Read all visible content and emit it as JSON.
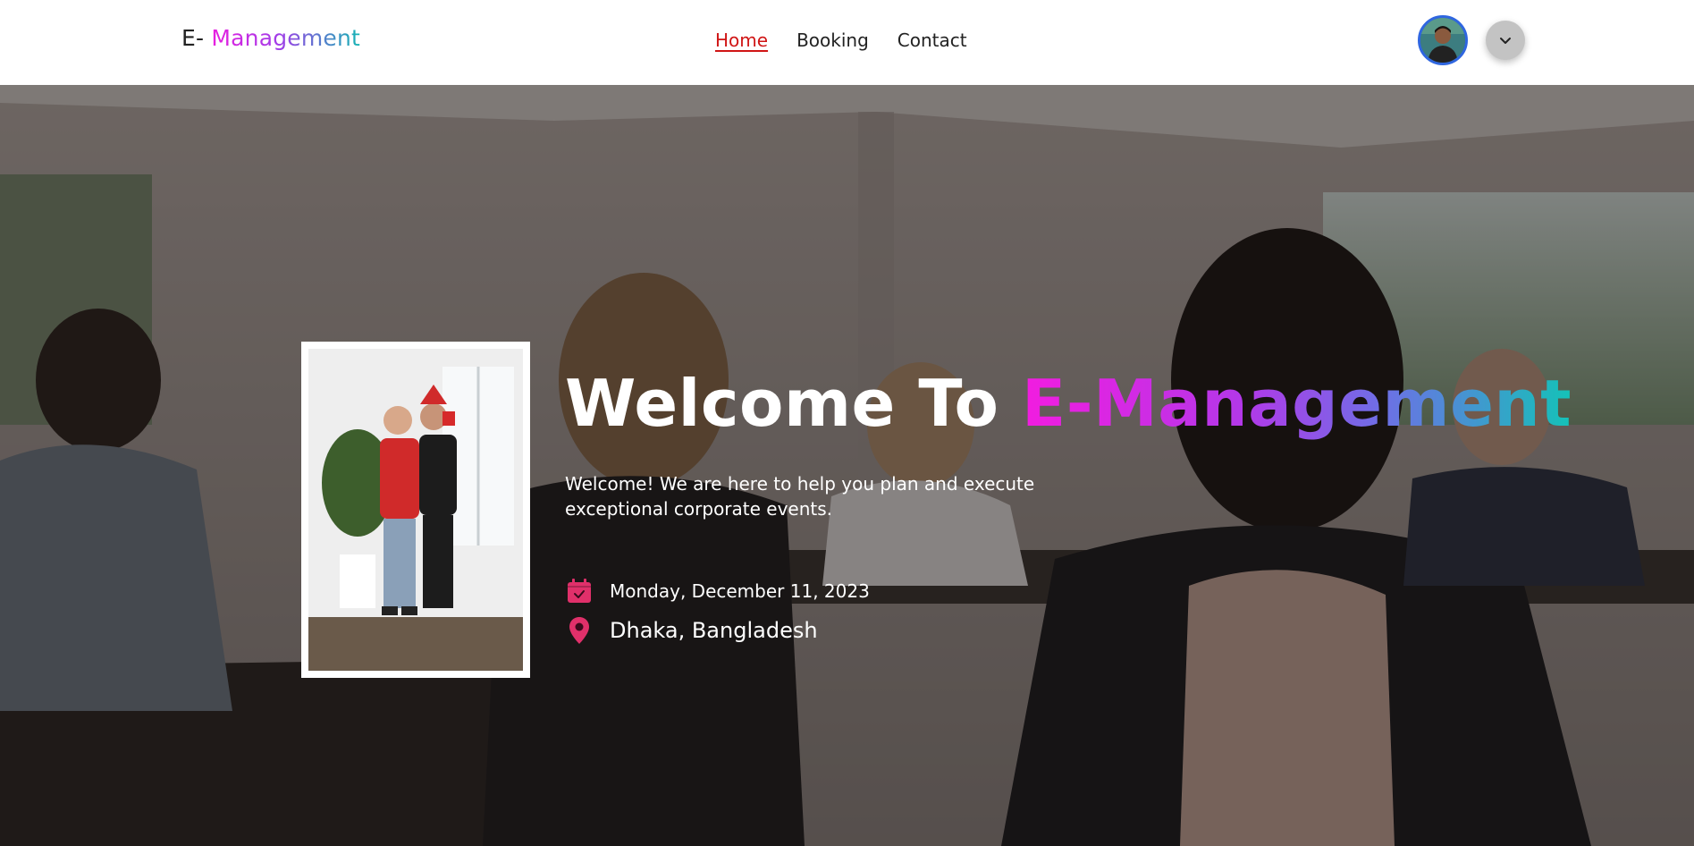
{
  "navbar": {
    "logo_prefix": "E-",
    "logo_name": "Management",
    "links": [
      {
        "label": "Home",
        "active": true
      },
      {
        "label": "Booking",
        "active": false
      },
      {
        "label": "Contact",
        "active": false
      }
    ],
    "avatar_icon": "user-avatar",
    "dropdown_icon": "chevron-down-icon"
  },
  "hero": {
    "title_prefix": "Welcome To",
    "title_highlight": "E-Management",
    "subtitle": "Welcome! We are here to help you plan and execute exceptional corporate events.",
    "event_date": "Monday, December 11, 2023",
    "event_location": "Dhaka, Bangladesh",
    "date_icon": "calendar-check-icon",
    "location_icon": "map-pin-icon"
  },
  "colors": {
    "accent": "#d01515",
    "icon_pink": "#e0306a",
    "gradient_start": "#f21ce0",
    "gradient_end": "#14c2b8"
  }
}
